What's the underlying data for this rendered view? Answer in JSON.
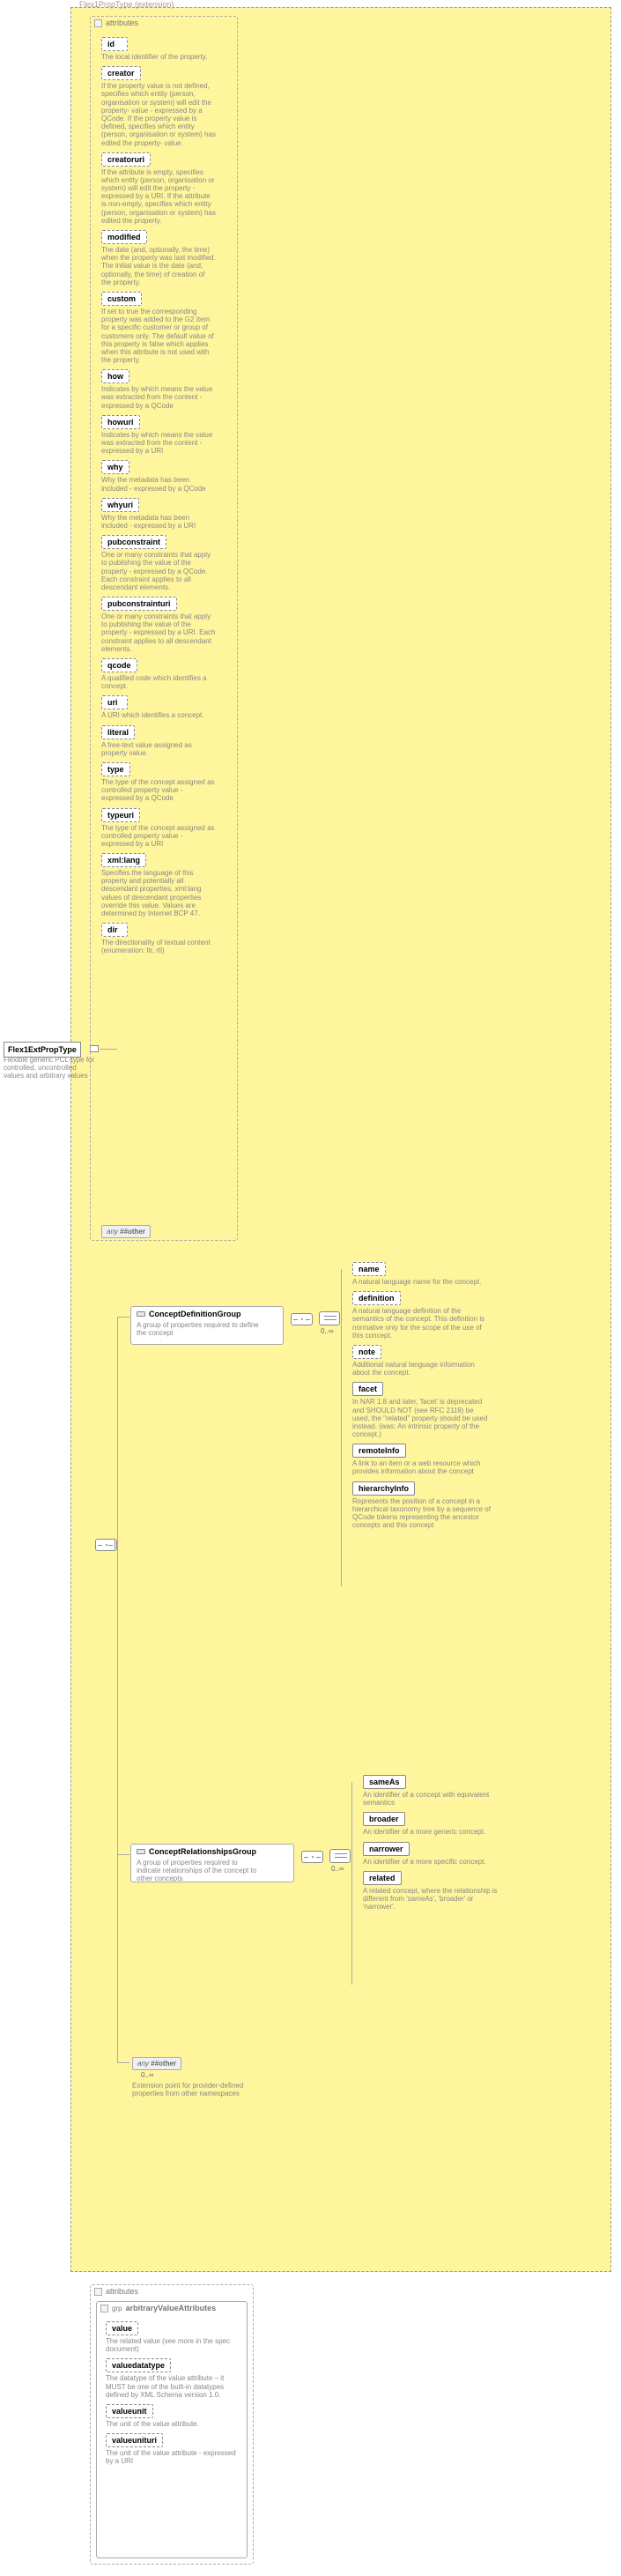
{
  "root": {
    "name": "Flex1ExtPropType",
    "desc": "Flexible generic PCL-type for controlled, uncontrolled values and arbitrary values"
  },
  "ext": {
    "label": "Flex1PropType (extension)"
  },
  "panel1_title": "attributes",
  "attrs": [
    {
      "name": "id",
      "desc": "The local identifier of the property."
    },
    {
      "name": "creator",
      "desc": "If the property value is not defined, specifies which entity (person, organisation or system) will edit the property- value - expressed by a QCode. If the property value is defined, specifies which entity (person, organisation or system) has edited the property- value."
    },
    {
      "name": "creatoruri",
      "desc": "If the attribute is empty, specifies which entity (person, organisation or system) will edit the property - expressed by a URI. If the attribute is non-empty, specifies which entity (person, organisation or system) has edited the property."
    },
    {
      "name": "modified",
      "desc": "The date (and, optionally, the time) when the property was last modified. The initial value is the date (and, optionally, the time) of creation of the property."
    },
    {
      "name": "custom",
      "desc": "If set to true the corresponding property was added to the G2 Item for a specific customer or group of customers only. The default value of this property is false which applies when this attribute is not used with the property."
    },
    {
      "name": "how",
      "desc": "Indicates by which means the value was extracted from the content - expressed by a QCode"
    },
    {
      "name": "howuri",
      "desc": "Indicates by which means the value was extracted from the content - expressed by a URI"
    },
    {
      "name": "why",
      "desc": "Why the metadata has been included - expressed by a QCode"
    },
    {
      "name": "whyuri",
      "desc": "Why the metadata has been included - expressed by a URI"
    },
    {
      "name": "pubconstraint",
      "desc": "One or many constraints that apply to publishing the value of the property - expressed by a QCode. Each constraint applies to all descendant elements."
    },
    {
      "name": "pubconstrainturi",
      "desc": "One or many constraints that apply to publishing the value of the property - expressed by a URI. Each constraint applies to all descendant elements."
    },
    {
      "name": "qcode",
      "desc": "A qualified code which identifies a concept."
    },
    {
      "name": "uri",
      "desc": "A URI which identifies a concept."
    },
    {
      "name": "literal",
      "desc": "A free-text value assigned as property value."
    },
    {
      "name": "type",
      "desc": "The type of the concept assigned as controlled property value - expressed by a QCode"
    },
    {
      "name": "typeuri",
      "desc": "The type of the concept assigned as controlled property value - expressed by a URI"
    },
    {
      "name": "xml:lang",
      "desc": "Specifies the language of this property and potentially all descendant properties. xml:lang values of descendant properties override this value. Values are determined by Internet BCP 47."
    },
    {
      "name": "dir",
      "desc": "The directionality of textual content (enumeration: ltr, rtl)"
    }
  ],
  "any_inline": {
    "label": "##other",
    "prefix": "any"
  },
  "groups": {
    "def": {
      "title": "ConceptDefinitionGroup",
      "desc": "A group of properties required to define the concept",
      "tally": "0..∞"
    },
    "rel": {
      "title": "ConceptRelationshipsGroup",
      "desc": "A group of properties required to indicate relationships of the concept to other concepts",
      "tally": "0..∞"
    }
  },
  "defItems": [
    {
      "name": "name",
      "desc": "A natural language name for the concept."
    },
    {
      "name": "definition",
      "desc": "A natural language definition of the semantics of the concept. This definition is normative only for the scope of the use of this concept."
    },
    {
      "name": "note",
      "desc": "Additional natural language information about the concept."
    },
    {
      "name": "facet",
      "solid": true,
      "desc": "In NAR 1.8 and later, 'facet' is deprecated and SHOULD NOT (see RFC 2119) be used, the \"related\" property should be used instead. (was: An intrinsic property of the concept.)"
    },
    {
      "name": "remoteInfo",
      "solid": true,
      "desc": "A link to an item or a web resource which provides information about the concept"
    },
    {
      "name": "hierarchyInfo",
      "solid": true,
      "desc": "Represents the position of a concept in a hierarchical taxonomy tree by a sequence of QCode tokens representing the ancestor concepts and this concept"
    }
  ],
  "relItems": [
    {
      "name": "sameAs",
      "solid": true,
      "desc": "An identifier of a concept with equivalent semantics"
    },
    {
      "name": "broader",
      "solid": true,
      "desc": "An identifier of a more generic concept."
    },
    {
      "name": "narrower",
      "solid": true,
      "desc": "An identifier of a more specific concept."
    },
    {
      "name": "related",
      "solid": true,
      "desc": "A related concept, where the relationship is different from 'sameAs', 'broader' or 'narrower'."
    }
  ],
  "anyElem": {
    "label": "##other",
    "tally": "0..∞",
    "desc": "Extension point for provider-defined properties from other namespaces",
    "prefix": "any"
  },
  "panel2": {
    "hdr": "attributes",
    "grp": "arbitraryValueAttributes",
    "items": [
      {
        "name": "value",
        "desc": "The related value (see more in the spec document)"
      },
      {
        "name": "valuedatatype",
        "desc": "The datatype of the value attribute – it MUST be one of the built-in datatypes defined by XML Schema version 1.0."
      },
      {
        "name": "valueunit",
        "desc": "The unit of the value attribute."
      },
      {
        "name": "valueunituri",
        "desc": "The unit of the value attribute - expressed by a URI"
      }
    ]
  }
}
